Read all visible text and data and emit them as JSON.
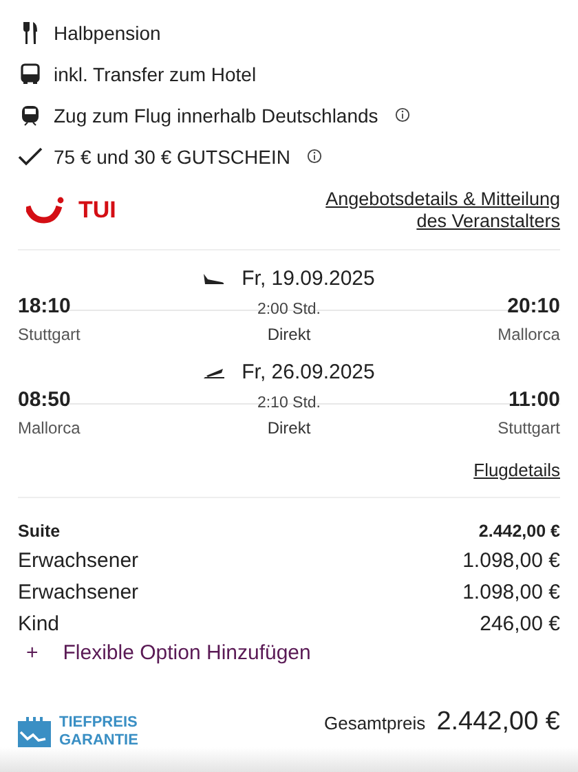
{
  "features": [
    {
      "kind": "meal",
      "text": "Halbpension",
      "info": false
    },
    {
      "kind": "bus",
      "text": "inkl. Transfer zum Hotel",
      "info": false
    },
    {
      "kind": "train",
      "text": "Zug zum Flug innerhalb Deutschlands",
      "info": true
    },
    {
      "kind": "check",
      "text": "75 € und 30 € GUTSCHEIN",
      "info": true
    }
  ],
  "operator": {
    "logo_text": "TUI",
    "link": "Angebotsdetails & Mitteilung des Veranstalters"
  },
  "flights": [
    {
      "kind": "outbound",
      "date": "Fr, 19.09.2025",
      "depart_time": "18:10",
      "depart_city": "Stuttgart",
      "duration": "2:00 Std.",
      "stops": "Direkt",
      "arrive_time": "20:10",
      "arrive_city": "Mallorca"
    },
    {
      "kind": "return",
      "date": "Fr, 26.09.2025",
      "depart_time": "08:50",
      "depart_city": "Mallorca",
      "duration": "2:10 Std.",
      "stops": "Direkt",
      "arrive_time": "11:00",
      "arrive_city": "Stuttgart"
    }
  ],
  "flight_details_link": "Flugdetails",
  "price_rows": [
    {
      "kind": "heading",
      "label": "Suite",
      "amount": "2.442,00 €"
    },
    {
      "kind": "item",
      "label": "Erwachsener",
      "amount": "1.098,00 €"
    },
    {
      "kind": "item",
      "label": "Erwachsener",
      "amount": "1.098,00 €"
    },
    {
      "kind": "item",
      "label": "Kind",
      "amount": "246,00 €"
    }
  ],
  "add_option": {
    "icon_text": "+",
    "label": "Flexible Option Hinzufügen"
  },
  "badge": {
    "line_1": "TIEFPREIS",
    "line_2": "GARANTIE"
  },
  "total": {
    "label": "Gesamtpreis",
    "amount": "2.442,00 €"
  }
}
